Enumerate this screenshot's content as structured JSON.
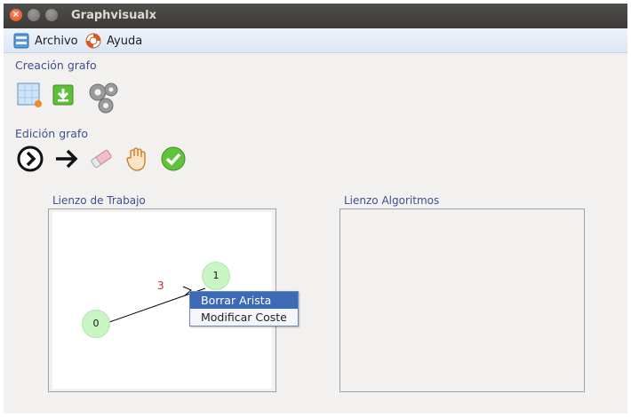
{
  "window": {
    "title": "Graphvisualx"
  },
  "menu": {
    "archivo": "Archivo",
    "ayuda": "Ayuda"
  },
  "sections": {
    "creacion": "Creación grafo",
    "edicion": "Edición grafo"
  },
  "panels": {
    "trabajo": "Lienzo de Trabajo",
    "algoritmos": "Lienzo Algoritmos"
  },
  "graph": {
    "nodes": [
      {
        "label": "0"
      },
      {
        "label": "1"
      }
    ],
    "edges": [
      {
        "from": "0",
        "to": "1",
        "cost": "3"
      }
    ]
  },
  "context_menu": {
    "items": [
      "Borrar Arista",
      "Modificar Coste"
    ],
    "selected_index": 0
  }
}
